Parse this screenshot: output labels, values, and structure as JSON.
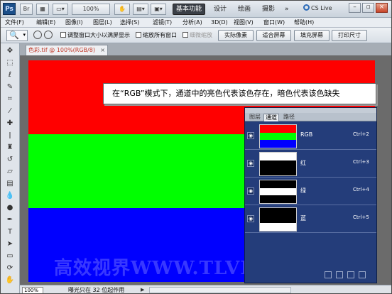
{
  "titlebar": {
    "logo": "Ps",
    "buttons": [
      "Br",
      "",
      "",
      "100%",
      "",
      ""
    ],
    "workspaces": [
      "基本功能",
      "设计",
      "绘画",
      "摄影"
    ],
    "active_workspace": "基本功能",
    "more": "»",
    "cslive": "CS Live"
  },
  "menu": [
    "文件(F)",
    "编辑(E)",
    "图像(I)",
    "图层(L)",
    "选择(S)",
    "滤镜(T)",
    "分析(A)",
    "3D(D)",
    "视图(V)",
    "窗口(W)",
    "帮助(H)"
  ],
  "options": {
    "check_resize": "调整窗口大小以满屏显示",
    "check_zoom_all": "缩放所有窗口",
    "check_scrubby": "细微缩放",
    "btn_actual": "实际像素",
    "btn_fit": "适合屏幕",
    "btn_fill": "填充屏幕",
    "btn_print": "打印尺寸"
  },
  "doc_tab": {
    "title": "色彩.tif @ 100%(RGB/8)",
    "close": "×"
  },
  "canvas": {
    "colors": [
      "#ff0000",
      "#00ff00",
      "#0000ff"
    ],
    "watermark": "高效视界WWW.TLVI.NET"
  },
  "callout": {
    "text": "在“RGB”模式下，通道中的亮色代表该色存在，暗色代表该色缺失"
  },
  "channels": {
    "tabs": [
      "图层",
      "通道",
      "路径"
    ],
    "active_tab": "通道",
    "rows": [
      {
        "name": "RGB",
        "shortcut": "Ctrl+2"
      },
      {
        "name": "红",
        "shortcut": "Ctrl+3"
      },
      {
        "name": "绿",
        "shortcut": "Ctrl+4"
      },
      {
        "name": "蓝",
        "shortcut": "Ctrl+5"
      }
    ]
  },
  "status": {
    "zoom": "100%",
    "text": "曝光只在 32 位起作用"
  }
}
